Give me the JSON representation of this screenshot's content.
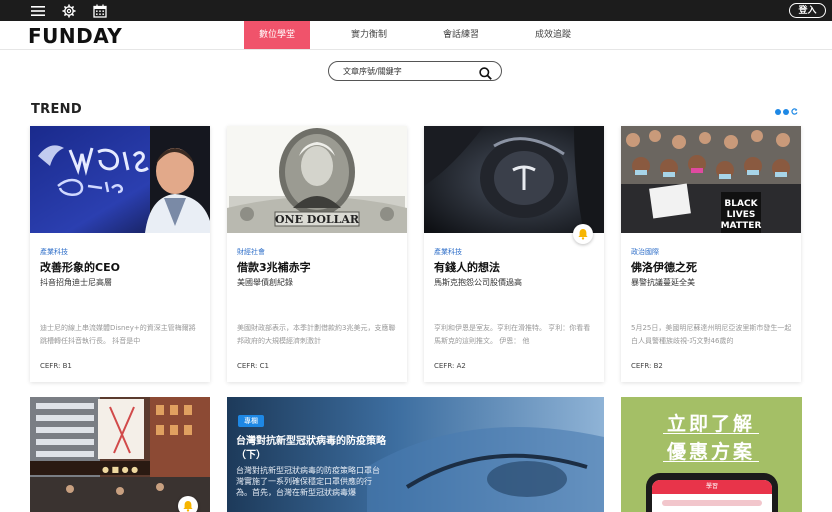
{
  "topbar": {
    "icons": [
      "menu-icon",
      "gear-icon",
      "calendar-icon"
    ],
    "login_label": "登入"
  },
  "header": {
    "logo": "FUNDAY",
    "nav": [
      {
        "label": "數位學堂",
        "active": true
      },
      {
        "label": "實力衡制",
        "active": false
      },
      {
        "label": "會話練習",
        "active": false
      },
      {
        "label": "成效追蹤",
        "active": false
      }
    ]
  },
  "search": {
    "placeholder": "文章序號/關鍵字"
  },
  "trend": {
    "title": "TREND",
    "cards": [
      {
        "category": "產業科技",
        "title": "改善形象的CEO",
        "subtitle": "抖音招角迪士尼高層",
        "desc": "迪士尼的線上串流媒體Disney+的資深主管梅爾將跳槽轉任抖音執行長。 抖音是中",
        "cefr": "CEFR: B1"
      },
      {
        "category": "財經社會",
        "title": "借款3兆補赤字",
        "subtitle": "美國舉債創紀錄",
        "desc": "美國財政部表示，本季計劃借款約3兆美元，支應聯邦政府的大規模經濟刺激計",
        "cefr": "CEFR: C1"
      },
      {
        "category": "產業科技",
        "title": "有錢人的想法",
        "subtitle": "馬斯克抱怨公司股價過高",
        "desc": "亨利和伊恩是室友。亨利在滑推特。 亨利：你看看馬斯克的這則推文。 伊恩： 他",
        "cefr": "CEFR: A2"
      },
      {
        "category": "政治國際",
        "title": "佛洛伊德之死",
        "subtitle": "暴警抗議蔓延全美",
        "desc": "5月25日，美國明尼蘇達州明尼亞波里斯市發生一起白人員警種族歧視-巧文對46歲的",
        "cefr": "CEFR: B2"
      }
    ]
  },
  "featured": {
    "tag": "專欄",
    "title": "台灣對抗新型冠狀病毒的防疫策略（下）",
    "desc": "台灣對抗新型冠狀病毒的防疫策略口罩台灣實施了一系列確保穩定口罩供應的行為。首先，台灣在新型冠狀病毒爆"
  },
  "promo": {
    "line1": "立即了解",
    "line2": "優惠方案",
    "phone_header": "學習"
  },
  "colors": {
    "accent": "#f0536b",
    "category_blue": "#2f6fc9",
    "tag_blue": "#1e88e5",
    "promo_green": "#a4bf66"
  }
}
